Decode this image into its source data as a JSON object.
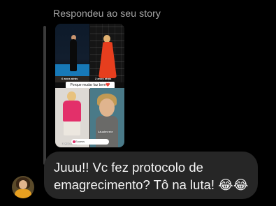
{
  "reply_label": "Respondeu ao seu story",
  "story": {
    "panels": [
      {
        "age_label": "6 anos atrás"
      },
      {
        "age_label": "2 anos atrás"
      },
      {
        "age_label": "1 ano atrás"
      },
      {
        "age_label": "Atualmente"
      }
    ],
    "caption": "Porque mudar faz bem❤️",
    "sticker_text": "Sucess"
  },
  "message": {
    "line1": "Juuu!! Vc fez protocolo de",
    "line2": "emagrecimento? Tô na luta! 😂😂"
  },
  "colors": {
    "background": "#000000",
    "bubble": "#262626",
    "label": "#a8a8a8"
  }
}
